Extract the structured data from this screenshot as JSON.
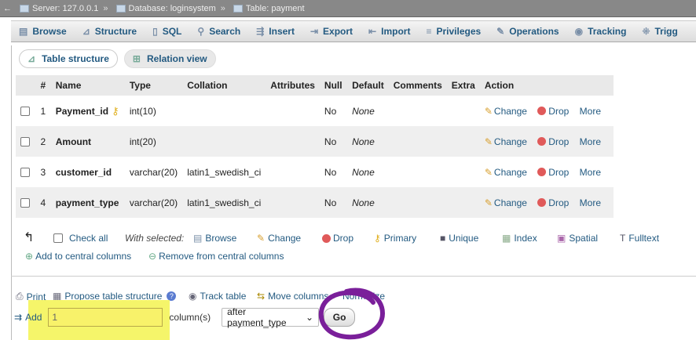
{
  "breadcrumb": {
    "server": "Server: 127.0.0.1",
    "database": "Database: loginsystem",
    "table": "Table: payment",
    "separator": "»"
  },
  "tabs": [
    {
      "label": "Browse",
      "icon": "browse-icon"
    },
    {
      "label": "Structure",
      "icon": "structure-icon"
    },
    {
      "label": "SQL",
      "icon": "sql-icon"
    },
    {
      "label": "Search",
      "icon": "search-icon"
    },
    {
      "label": "Insert",
      "icon": "insert-icon"
    },
    {
      "label": "Export",
      "icon": "export-icon"
    },
    {
      "label": "Import",
      "icon": "import-icon"
    },
    {
      "label": "Privileges",
      "icon": "privileges-icon"
    },
    {
      "label": "Operations",
      "icon": "wrench-icon"
    },
    {
      "label": "Tracking",
      "icon": "eye-icon"
    },
    {
      "label": "Trigg",
      "icon": "trigger-icon"
    }
  ],
  "subtabs": {
    "structure": "Table structure",
    "relation": "Relation view"
  },
  "table": {
    "headers": [
      "#",
      "Name",
      "Type",
      "Collation",
      "Attributes",
      "Null",
      "Default",
      "Comments",
      "Extra",
      "Action"
    ],
    "rows": [
      {
        "num": "1",
        "name": "Payment_id",
        "type": "int(10)",
        "collation": "",
        "null": "No",
        "default": "None",
        "primary": true
      },
      {
        "num": "2",
        "name": "Amount",
        "type": "int(20)",
        "collation": "",
        "null": "No",
        "default": "None",
        "primary": false
      },
      {
        "num": "3",
        "name": "customer_id",
        "type": "varchar(20)",
        "collation": "latin1_swedish_ci",
        "null": "No",
        "default": "None",
        "primary": false
      },
      {
        "num": "4",
        "name": "payment_type",
        "type": "varchar(20)",
        "collation": "latin1_swedish_ci",
        "null": "No",
        "default": "None",
        "primary": false
      }
    ],
    "row_actions": {
      "change": "Change",
      "drop": "Drop",
      "more": "More"
    }
  },
  "bulk": {
    "check_all": "Check all",
    "with_selected": "With selected:",
    "browse": "Browse",
    "change": "Change",
    "drop": "Drop",
    "primary": "Primary",
    "unique": "Unique",
    "index": "Index",
    "spatial": "Spatial",
    "fulltext": "Fulltext",
    "add_central": "Add to central columns",
    "remove_central": "Remove from central columns"
  },
  "bottom": {
    "print": "Print",
    "propose": "Propose table structure",
    "track": "Track table",
    "move": "Move columns",
    "normalize": "Normalize"
  },
  "add_column": {
    "label": "Add",
    "value": "1",
    "suffix": "column(s)",
    "position": "after payment_type",
    "go": "Go"
  },
  "colors": {
    "link": "#235a81",
    "highlight": "#f5f56a",
    "annotation": "#7a1f9a"
  }
}
